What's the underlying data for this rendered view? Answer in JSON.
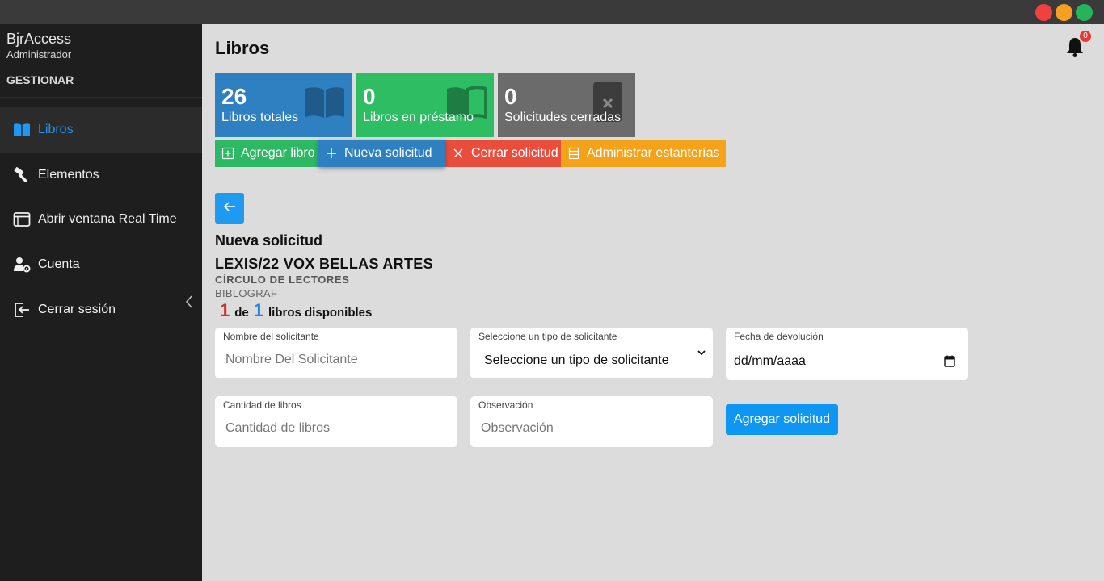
{
  "sidebar": {
    "app_name": "BjrAccess",
    "role": "Administrador",
    "section": "GESTIONAR",
    "items": [
      {
        "label": "Libros",
        "icon": "book-icon",
        "active": true
      },
      {
        "label": "Elementos",
        "icon": "hammer-icon"
      },
      {
        "label": "Abrir ventana Real Time",
        "icon": "window-icon"
      },
      {
        "label": "Cuenta",
        "icon": "user-gear-icon"
      },
      {
        "label": "Cerrar sesión",
        "icon": "logout-icon"
      }
    ]
  },
  "header": {
    "title": "Libros",
    "notification_count": "0"
  },
  "stats": [
    {
      "value": "26",
      "label": "Libros totales",
      "color": "#2f80c0",
      "icon": "open-book-icon"
    },
    {
      "value": "0",
      "label": "Libros en préstamo",
      "color": "#2ebd63",
      "icon": "open-book-icon"
    },
    {
      "value": "0",
      "label": "Solicitudes cerradas",
      "color": "#6b6b6b",
      "icon": "close-box-icon"
    }
  ],
  "actions": [
    {
      "label": "Agregar libro",
      "color": "#2db863",
      "icon": "add-book-icon"
    },
    {
      "label": "Nueva solicitud",
      "color": "#2f80c0",
      "icon": "plus-icon"
    },
    {
      "label": "Cerrar solicitud",
      "color": "#eb4d3d",
      "icon": "x-icon"
    },
    {
      "label": "Administrar estanterías",
      "color": "#f5a21b",
      "icon": "shelf-icon"
    }
  ],
  "form": {
    "title": "Nueva solicitud",
    "book": {
      "title": "LEXIS/22 VOX BELLAS ARTES",
      "author": "CÍRCULO DE LECTORES",
      "publisher": "BIBLOGRAF"
    },
    "availability": {
      "available": "1",
      "of": "de",
      "total": "1",
      "suffix": "libros disponibles"
    },
    "fields": {
      "name": {
        "label": "Nombre del solicitante",
        "placeholder": "Nombre Del Solicitante"
      },
      "type": {
        "label": "Seleccione un tipo de solicitante",
        "value": "Seleccione un tipo de solicitante"
      },
      "date": {
        "label": "Fecha de devolución",
        "value": "dd/mm/aaaa"
      },
      "quantity": {
        "label": "Cantidad de libros",
        "placeholder": "Cantidad de libros"
      },
      "notes": {
        "label": "Observación",
        "placeholder": "Observación"
      }
    },
    "submit_label": "Agregar solicitud"
  }
}
